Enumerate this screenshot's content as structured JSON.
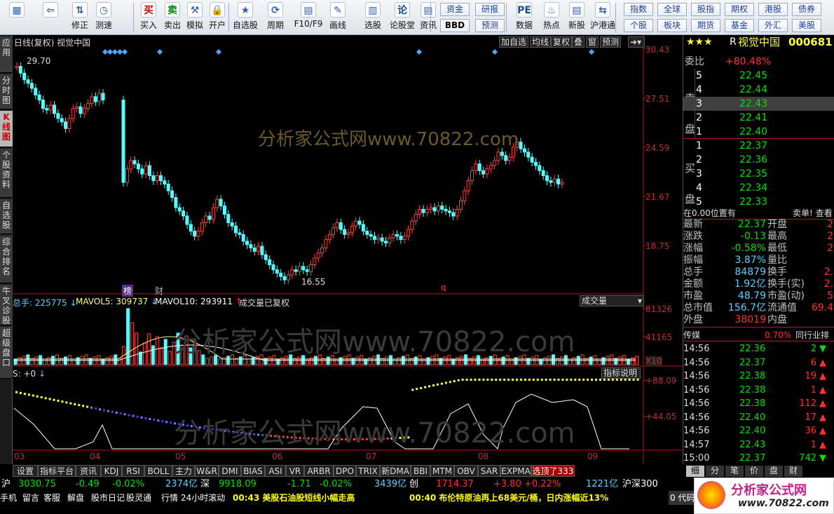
{
  "toolbar": {
    "buttons": [
      {
        "label": "",
        "icon": "windows-icon"
      },
      {
        "label": "",
        "icon": "back-arrow-icon"
      },
      {
        "label": "修正",
        "icon": "up-down-arrows-icon"
      },
      {
        "label": "测速",
        "icon": "clock-icon"
      },
      {
        "label": "买入",
        "icon": "buy-icon",
        "glyph": "买"
      },
      {
        "label": "卖出",
        "icon": "sell-icon",
        "glyph": "卖"
      },
      {
        "label": "模拟",
        "icon": "hammer-icon"
      },
      {
        "label": "开户",
        "icon": "lock-icon"
      },
      {
        "label": "自选股",
        "icon": "star-icon"
      },
      {
        "label": "周期",
        "icon": "cycle-icon"
      },
      {
        "label": "F10/F9",
        "icon": "f10-icon"
      },
      {
        "label": "画线",
        "icon": "pen-icon"
      },
      {
        "label": "选股",
        "icon": "select-icon"
      },
      {
        "label": "论股堂",
        "icon": "discuss-icon",
        "glyph": "论"
      },
      {
        "label": "资讯",
        "icon": "news-icon"
      },
      {
        "label": "数据",
        "icon": "pe-icon",
        "glyph": "PE"
      },
      {
        "label": "热点",
        "icon": "fire-icon"
      },
      {
        "label": "新股",
        "icon": "new-stock-icon"
      },
      {
        "label": "沪港通",
        "icon": "hk-icon"
      }
    ],
    "right_grid": [
      "资金",
      "研报",
      "指数",
      "全球",
      "股指",
      "期权",
      "港股",
      "债券",
      "BBD",
      "预测",
      "个股",
      "板块",
      "期货",
      "基金",
      "外汇",
      "美股"
    ]
  },
  "leftnav": [
    "应用",
    "分时图",
    "K线图",
    "个股资料",
    "自选股",
    "综合排名",
    "牛叉诊股",
    "超级盘口"
  ],
  "chart": {
    "title": "日线(复权) 视觉中国",
    "header_buttons": [
      "加自选",
      "均线",
      "复权",
      "叠",
      "窗",
      "预测"
    ],
    "price_axis": [
      "30.43",
      "27.51",
      "24.59",
      "21.67",
      "18.75"
    ],
    "high_label": "29.70",
    "low_label": "16.55",
    "markers": [
      "榜",
      "财",
      "q"
    ],
    "watermark": "分析家公式网www.70822.com",
    "volume": {
      "label_total": "总手: 225775",
      "label_mavol5": "MAVOL5: 309737",
      "label_mavol10": "MAVOL10: 293911",
      "note": "成交量已复权",
      "selector": "成交量",
      "axis": [
        "81326",
        "41165",
        "X10"
      ]
    },
    "indicator": {
      "label": "S: +0",
      "button": "指标说明",
      "axis": [
        "+88.09",
        "+44.05"
      ]
    },
    "months": [
      "03",
      "04",
      "05",
      "06",
      "07",
      "08",
      "09"
    ]
  },
  "quote": {
    "stars": "★★★",
    "r": "R",
    "name": "视觉中国",
    "code": "000681",
    "weibi_label": "委比",
    "weibi": "+80.48%",
    "sell_label": "卖盘",
    "buy_label": "买盘",
    "asks": [
      {
        "lvl": "5",
        "price": "22.45"
      },
      {
        "lvl": "4",
        "price": "22.44"
      },
      {
        "lvl": "3",
        "price": "22.43"
      },
      {
        "lvl": "2",
        "price": "22.41"
      },
      {
        "lvl": "1",
        "price": "22.40"
      }
    ],
    "bids": [
      {
        "lvl": "1",
        "price": "22.37"
      },
      {
        "lvl": "2",
        "price": "22.36"
      },
      {
        "lvl": "3",
        "price": "22.35"
      },
      {
        "lvl": "4",
        "price": "22.34"
      },
      {
        "lvl": "5",
        "price": "22.33"
      }
    ],
    "pos_text": "在0.00位置有",
    "pos_right": "卖单! 查看",
    "stats": [
      {
        "k": "最新",
        "v": "22.37",
        "k2": "开盘",
        "v2": "2"
      },
      {
        "k": "涨跌",
        "v": "-0.13",
        "k2": "最高",
        "v2": "2"
      },
      {
        "k": "涨幅",
        "v": "-0.58%",
        "k2": "最低",
        "v2": "2"
      },
      {
        "k": "振幅",
        "v": "3.87%",
        "k2": "量比",
        "v2": ""
      },
      {
        "k": "总手",
        "v": "84879",
        "k2": "换手",
        "v2": "2."
      },
      {
        "k": "金额",
        "v": "1.92亿",
        "k2": "换手(实)",
        "v2": "2."
      },
      {
        "k": "市盈",
        "v": "48.79",
        "k2": "市盈(动)",
        "v2": "5"
      },
      {
        "k": "总市值",
        "v": "156.7亿",
        "k2": "流通值",
        "v2": "69.4"
      },
      {
        "k": "外盘",
        "v": "38019",
        "k2": "内盘",
        "v2": ""
      }
    ],
    "industry": "传媒",
    "industry_pct": "0.70%",
    "industry_right": "同行业排",
    "ticks": [
      {
        "t": "14:56",
        "p": "22.36",
        "v": "2",
        "dir": "down"
      },
      {
        "t": "14:56",
        "p": "22.37",
        "v": "6",
        "dir": "up"
      },
      {
        "t": "14:56",
        "p": "22.38",
        "v": "19",
        "dir": "up"
      },
      {
        "t": "14:56",
        "p": "22.38",
        "v": "1",
        "dir": "up"
      },
      {
        "t": "14:56",
        "p": "22.38",
        "v": "112",
        "dir": "up"
      },
      {
        "t": "14:56",
        "p": "22.40",
        "v": "17",
        "dir": "up"
      },
      {
        "t": "14:56",
        "p": "22.40",
        "v": "36",
        "dir": "up"
      },
      {
        "t": "14:57",
        "p": "22.43",
        "v": "1",
        "dir": "up"
      },
      {
        "t": "15:00",
        "p": "22.37",
        "v": "742",
        "dir": "down"
      }
    ],
    "bottom_tabs": [
      "细",
      "分",
      "笔",
      "价",
      "盘",
      "财"
    ]
  },
  "tabs": [
    "设置",
    "指标平台",
    "资讯",
    "KDJ",
    "RSI",
    "BOLL",
    "主力",
    "W&R",
    "DMI",
    "BIAS",
    "ASI",
    "VR",
    "ARBR",
    "DPO",
    "TRIX",
    "新DMA",
    "BBI",
    "MTM",
    "OBV",
    "SAR",
    "EXPMA",
    "选顶了333"
  ],
  "status1": {
    "sh_label": "沪",
    "sh": "3030.75",
    "sh_chg": "-0.49",
    "sh_pct": "-0.02%",
    "sh_amt": "2374亿",
    "sz_label": "深",
    "sz": "9918.09",
    "sz_chg": "-1.71",
    "sz_pct": "-0.02%",
    "sz_amt": "3439亿",
    "cy_label": "创",
    "cy": "1714.37",
    "cy_chg": "+3.80",
    "cy_pct": "+0.22%",
    "cy_amt": "1221亿",
    "hs_label": "沪深300"
  },
  "status2": {
    "items": [
      "手机",
      "留言",
      "客服",
      "解盘",
      "股市日记",
      "股灵通",
      "行情",
      "24小时滚动"
    ],
    "news1": "00:43 美股石油股短线小幅走高",
    "news2": "00:40 布伦特原油再上68美元/桶，日内涨幅近13%",
    "right": "0 代码",
    "logo": "分析家公式网",
    "logo_url": "www.70822.com"
  }
}
